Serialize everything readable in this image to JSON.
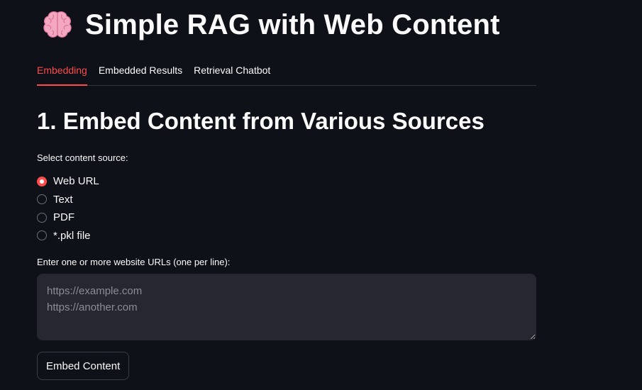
{
  "app": {
    "title": "Simple RAG with Web Content",
    "title_icon": "brain-icon"
  },
  "tabs": [
    {
      "label": "Embedding",
      "active": true
    },
    {
      "label": "Embedded Results",
      "active": false
    },
    {
      "label": "Retrieval Chatbot",
      "active": false
    }
  ],
  "section": {
    "heading": "1. Embed Content from Various Sources"
  },
  "source_select": {
    "label": "Select content source:",
    "options": [
      {
        "label": "Web URL",
        "checked": true
      },
      {
        "label": "Text",
        "checked": false
      },
      {
        "label": "PDF",
        "checked": false
      },
      {
        "label": "*.pkl file",
        "checked": false
      }
    ]
  },
  "url_input": {
    "label": "Enter one or more website URLs (one per line):",
    "placeholder": "https://example.com\nhttps://another.com",
    "value": ""
  },
  "embed_button": {
    "label": "Embed Content"
  },
  "colors": {
    "background": "#0e1117",
    "accent": "#ff4b4b",
    "input_background": "#262730",
    "text": "#fafafa",
    "divider": "#31333f"
  }
}
